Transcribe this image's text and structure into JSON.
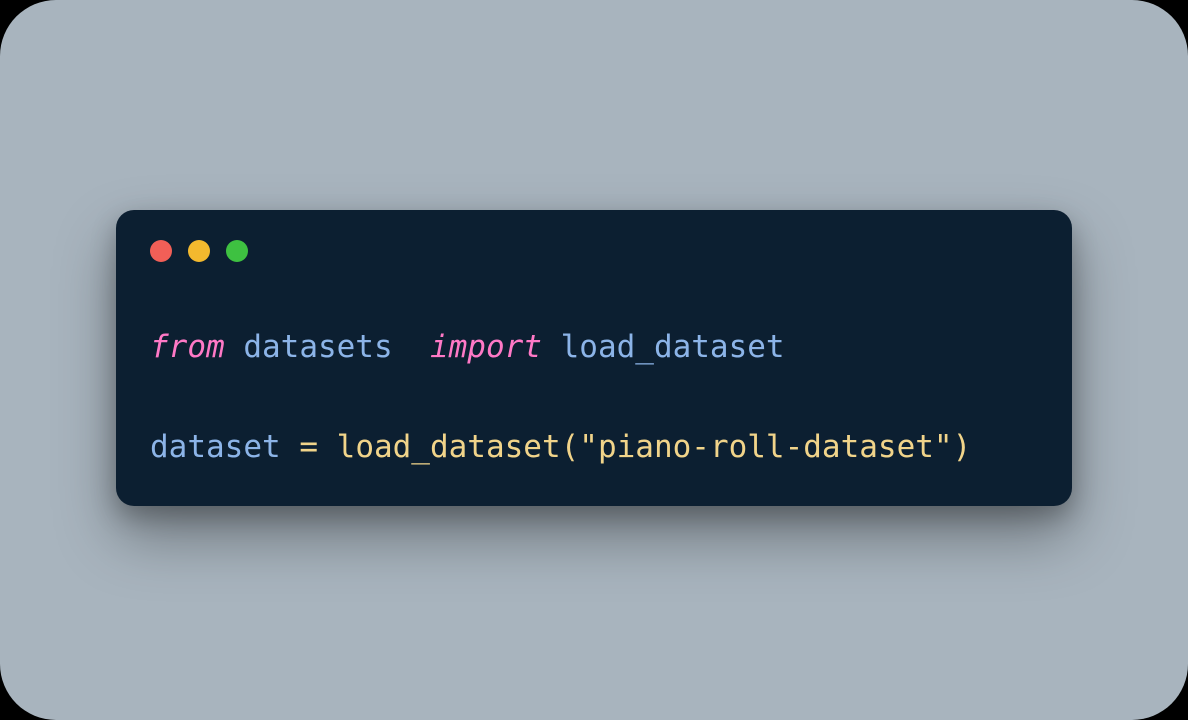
{
  "window": {
    "controls": {
      "red": "close",
      "yellow": "minimize",
      "green": "maximize"
    }
  },
  "code": {
    "line1": {
      "from_kw": "from",
      "module": "datasets",
      "import_kw": "import",
      "name": "load_dataset"
    },
    "line2": {
      "var": "dataset",
      "eq": "= ",
      "func": "load_dataset",
      "open_paren": "(",
      "string": "\"piano-roll-dataset\"",
      "close_paren": ")"
    }
  }
}
